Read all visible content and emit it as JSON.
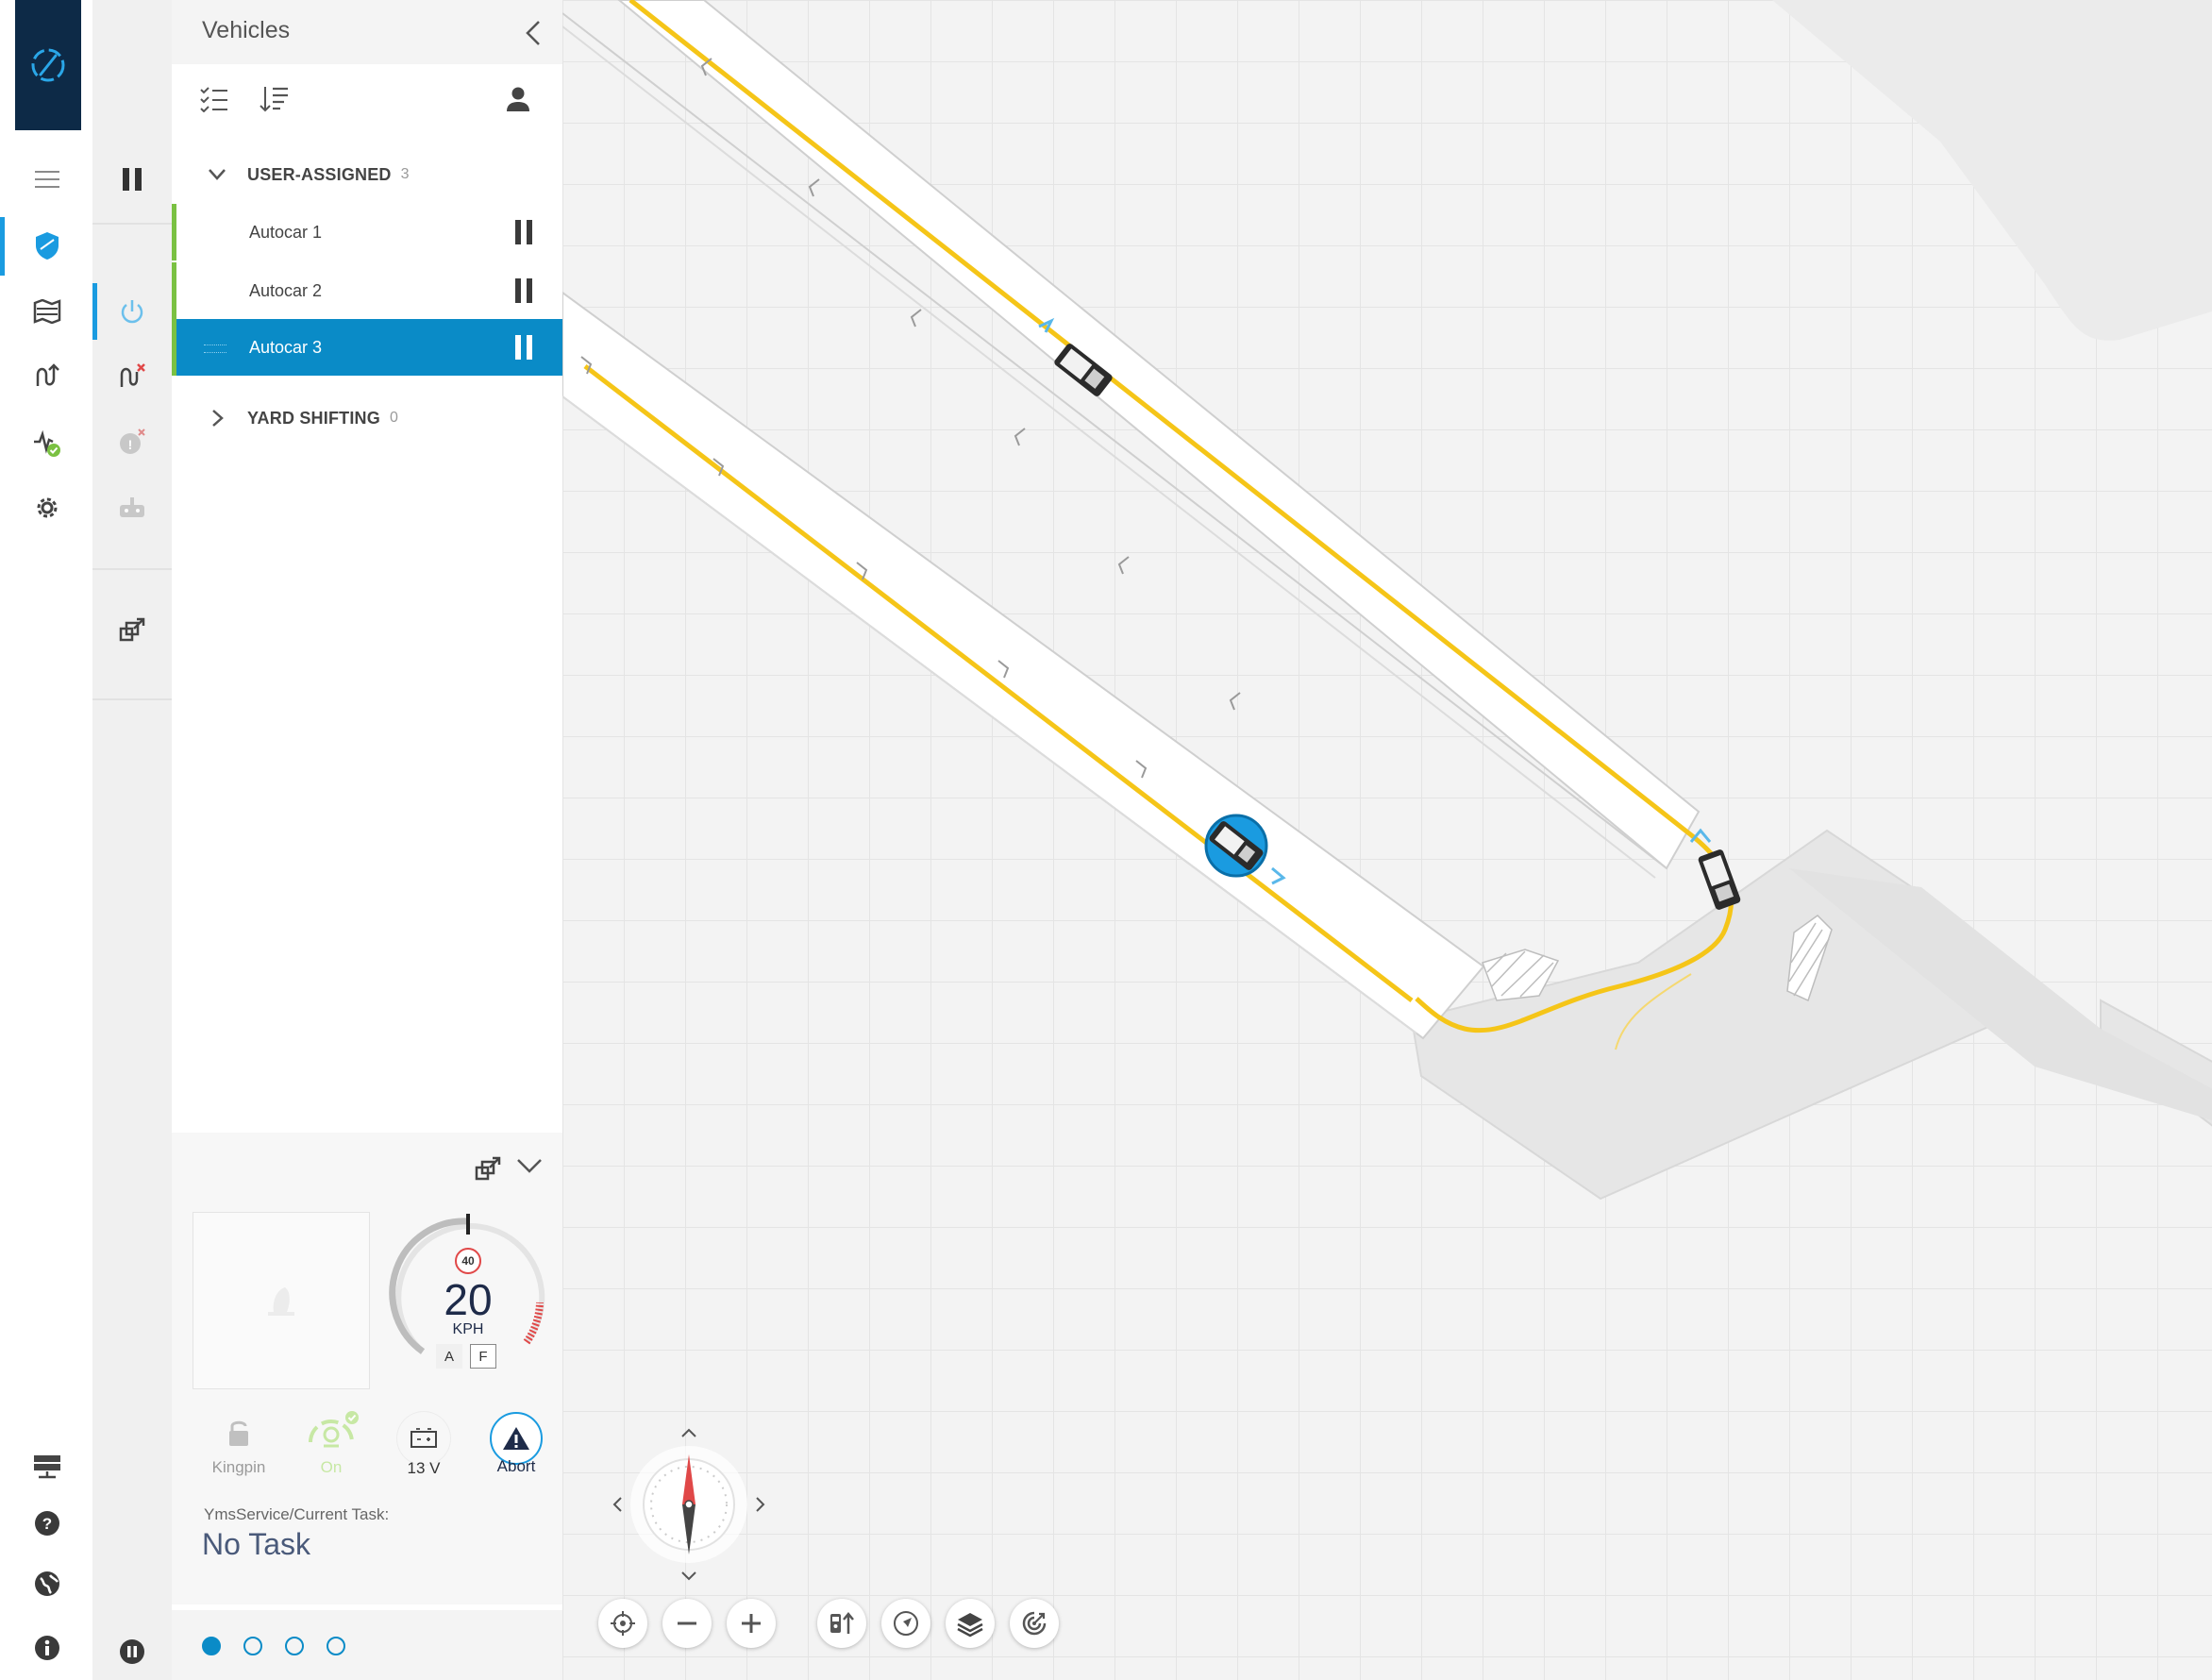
{
  "panel": {
    "title": "Vehicles"
  },
  "groups": [
    {
      "label": "USER-ASSIGNED",
      "count": "3",
      "expanded": true
    },
    {
      "label": "YARD SHIFTING",
      "count": "0",
      "expanded": false
    }
  ],
  "vehicles": [
    {
      "label": "Autocar 1",
      "selected": false
    },
    {
      "label": "Autocar 2",
      "selected": false
    },
    {
      "label": "Autocar 3",
      "selected": true
    }
  ],
  "detail": {
    "speed_limit": "40",
    "speed": "20",
    "speed_unit": "KPH",
    "mode_a": "A",
    "mode_f": "F",
    "stats": {
      "kingpin": "Kingpin",
      "on": "On",
      "voltage": "13 V",
      "abort": "Abort"
    },
    "task_label": "YmsService/Current Task:",
    "task_value": "No Task"
  },
  "pager": {
    "total": 4,
    "active": 0
  },
  "colors": {
    "accent": "#1a9be0",
    "selected_row": "#0a8bc7",
    "assigned_marker": "#7ac142",
    "route": "#f5c518",
    "logo_bg": "#0d2a47"
  },
  "icons": {
    "rail": [
      "menu-icon",
      "shield-icon",
      "map-icon",
      "route-icon",
      "health-check-icon",
      "gear-icon",
      "server-icon",
      "help-icon",
      "globe-icon",
      "info-icon"
    ],
    "map_tools": [
      "locate-icon",
      "zoom-out-icon",
      "zoom-in-icon",
      "vehicle-follow-icon",
      "navigate-icon",
      "layers-icon",
      "target-icon"
    ]
  }
}
